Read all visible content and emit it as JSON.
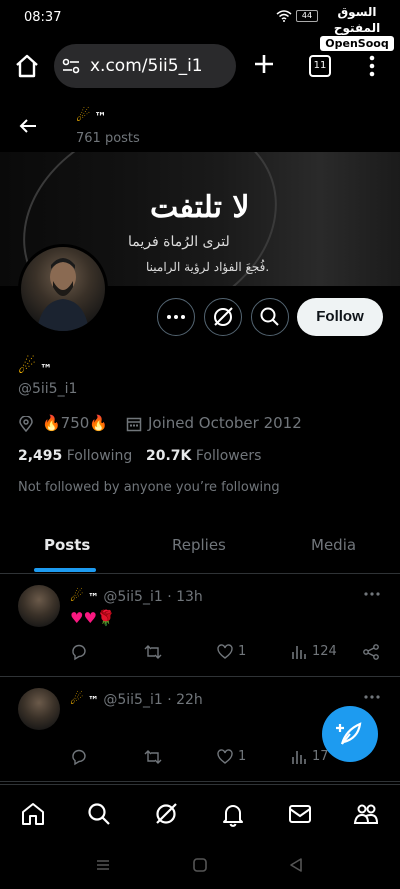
{
  "status_bar": {
    "time": "08:37",
    "battery": "44"
  },
  "watermark": {
    "arabic": "السوق المفتوح",
    "brand": "OpenSooq"
  },
  "browser": {
    "url": "x.com/5ii5_i1",
    "tab_count": "11"
  },
  "profile_header": {
    "name": "™",
    "posts_count": "761 posts"
  },
  "banner": {
    "title": "لا تلتفت",
    "line2": "لترى الرُماة فريما",
    "line3": "فُجعَ الفؤاد لرؤية الرامينا."
  },
  "profile": {
    "name": "™",
    "handle": "@5ii5_i1",
    "location": "🔥750🔥",
    "joined": "Joined October 2012",
    "following_count": "2,495",
    "following_label": "Following",
    "followers_count": "20.7K",
    "followers_label": "Followers",
    "not_followed": "Not followed by anyone you’re following",
    "follow_button": "Follow"
  },
  "tabs": [
    {
      "label": "Posts",
      "active": true
    },
    {
      "label": "Replies",
      "active": false
    },
    {
      "label": "Media",
      "active": false
    }
  ],
  "posts": [
    {
      "name": "™",
      "handle": "@5ii5_i1",
      "time": "13h",
      "text": "♥♥🌹",
      "likes": "1",
      "views": "124"
    },
    {
      "name": "™",
      "handle": "@5ii5_i1",
      "time": "22h",
      "text": "",
      "likes": "1",
      "views": "17"
    }
  ],
  "colors": {
    "accent": "#1d9bf0",
    "background": "#000000",
    "muted": "#71767b",
    "like": "#f91880"
  }
}
